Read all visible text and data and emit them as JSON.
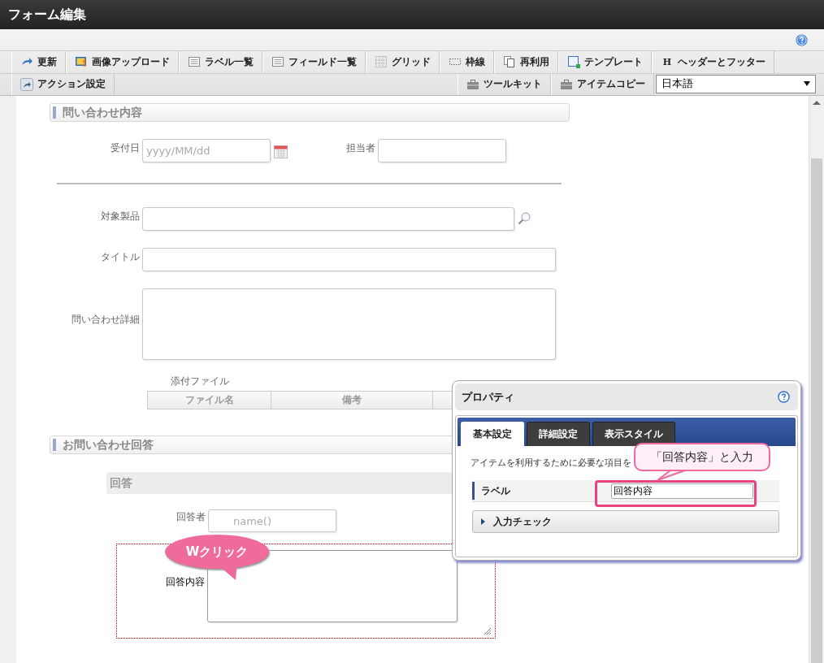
{
  "window": {
    "title": "フォーム編集"
  },
  "toolbar": {
    "row1": [
      {
        "label": "更新",
        "kind": "refresh"
      },
      {
        "label": "画像アップロード",
        "kind": "image"
      },
      {
        "label": "ラベル一覧",
        "kind": "list"
      },
      {
        "label": "フィールド一覧",
        "kind": "list"
      },
      {
        "label": "グリッド",
        "kind": "grid"
      },
      {
        "label": "枠線",
        "kind": "frame"
      },
      {
        "label": "再利用",
        "kind": "pages"
      },
      {
        "label": "テンプレート",
        "kind": "template"
      },
      {
        "label": "ヘッダーとフッター",
        "kind": "glyph",
        "glyph": "H"
      }
    ],
    "row2_left": [
      {
        "label": "アクション設定",
        "kind": "share"
      }
    ],
    "row2_right": [
      {
        "label": "ツールキット",
        "kind": "case"
      },
      {
        "label": "アイテムコピー",
        "kind": "case"
      }
    ],
    "language": "日本語"
  },
  "canvas": {
    "section1": "問い合わせ内容",
    "date_label": "受付日",
    "date_placeholder": "yyyy/MM/dd",
    "assignee_label": "担当者",
    "product_label": "対象製品",
    "title_label": "タイトル",
    "detail_label": "問い合わせ詳細",
    "attach_label": "添付ファイル",
    "attach_columns": [
      "ファイル名",
      "備考"
    ],
    "section2": "お問い合わせ回答",
    "subsection": "回答",
    "answerer_label": "回答者",
    "answerer_placeholder": "name()",
    "content_label": "回答内容",
    "content_selected": true
  },
  "properties": {
    "title": "プロパティ",
    "tabs": [
      {
        "label": "基本設定",
        "selected": true
      },
      {
        "label": "詳細設定",
        "selected": false
      },
      {
        "label": "表示スタイル",
        "selected": false
      }
    ],
    "description": "アイテムを利用するために必要な項目を",
    "label_name": "ラベル",
    "label_value": "回答内容",
    "accordion": {
      "label": "入力チェック",
      "expanded": false
    }
  },
  "callouts": [
    "Wクリック",
    "「回答内容」と入力"
  ]
}
